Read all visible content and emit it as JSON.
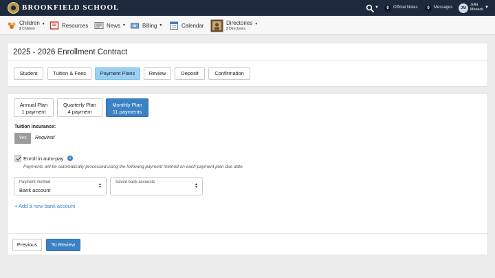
{
  "header": {
    "school_name": "BROOKFIELD SCHOOL",
    "official_notes_count": "0",
    "official_notes_label": "Official Notes",
    "messages_count": "0",
    "messages_label": "Messages",
    "user_initials": "JM",
    "user_first": "Julia",
    "user_last": "Meseck"
  },
  "nav": {
    "children_label": "Children",
    "children_count": "2",
    "children_sub": "Children",
    "resources_label": "Resources",
    "news_label": "News",
    "billing_label": "Billing",
    "calendar_label": "Calendar",
    "directories_label": "Directories",
    "directories_count": "2",
    "directories_sub": "Directories"
  },
  "page": {
    "title": "2025 - 2026 Enrollment Contract",
    "steps": [
      "Student",
      "Tuition & Fees",
      "Payment Plans",
      "Review",
      "Deposit",
      "Confirmation"
    ],
    "active_step": "Payment Plans"
  },
  "plans": [
    {
      "name": "Annual Plan",
      "detail": "1 payment"
    },
    {
      "name": "Quarterly Plan",
      "detail": "4 payment"
    },
    {
      "name": "Monthly Plan",
      "detail": "11 payments"
    }
  ],
  "selected_plan": "Monthly Plan",
  "insurance": {
    "label": "Tuition Insurance:",
    "yes_label": "Yes",
    "required_text": "Required"
  },
  "autopay": {
    "checked": true,
    "label": "Enroll in auto-pay",
    "help": "Payments will be automatically processed using the following payment method on each payment plan due date."
  },
  "payment_method": {
    "label": "Payment method",
    "value": "Bank account"
  },
  "saved_accounts": {
    "label": "Saved bank accounts",
    "value": ""
  },
  "add_bank_label": "+ Add a new bank account",
  "buttons": {
    "previous": "Previous",
    "to_review": "To Review"
  },
  "colors": {
    "topbar": "#1d2a3d",
    "accent": "#3b82c4",
    "active_tab": "#99d1f4"
  }
}
